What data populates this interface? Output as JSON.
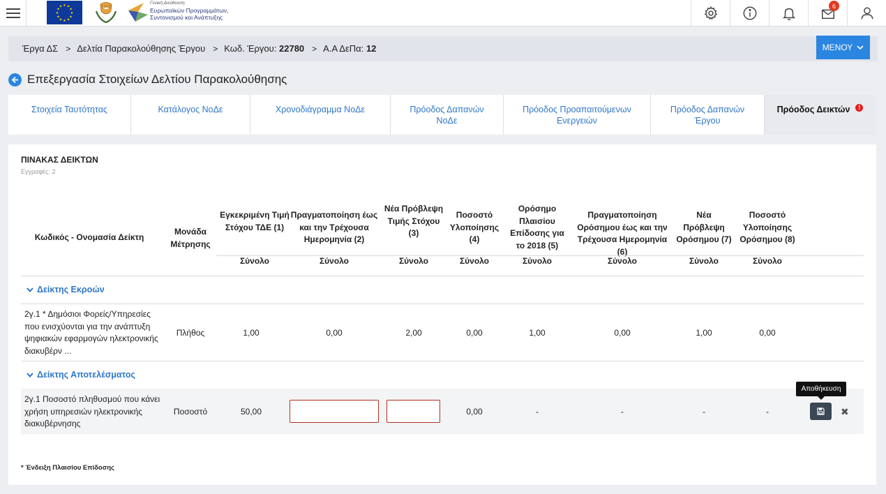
{
  "header": {
    "ministry_logo_line1": "Γενική Διεύθυνση",
    "ministry_logo_line2": "Ευρωπαϊκών Προγραμμάτων,",
    "ministry_logo_line3": "Συντονισμού και Ανάπτυξης",
    "notification_count": "6"
  },
  "breadcrumb": {
    "item1": "Έργα ΔΣ",
    "item2": "Δελτία Παρακολούθησης Έργου",
    "item3_label": "Κωδ. Έργου:",
    "item3_value": "22780",
    "item4_label": "Α.Α ΔεΠα:",
    "item4_value": "12",
    "menu_label": "ΜΕΝΟΥ"
  },
  "page": {
    "title": "Επεξεργασία Στοιχείων Δελτίου Παρακολούθησης"
  },
  "tabs": [
    {
      "label": "Στοιχεία Ταυτότητας"
    },
    {
      "label": "Κατάλογος ΝοΔε"
    },
    {
      "label": "Χρονοδιάγραμμα ΝοΔε"
    },
    {
      "label": "Πρόοδος Δαπανών ΝοΔε"
    },
    {
      "label": "Πρόοδος Προαπαιτούμενων Ενεργειών"
    },
    {
      "label": "Πρόοδος Δαπανών Έργου"
    },
    {
      "label": "Πρόοδος Δεικτών",
      "alert": "!"
    }
  ],
  "table": {
    "title": "ΠΙΝΑΚΑΣ ΔΕΙΚΤΩΝ",
    "record_count": "Εγγραφές: 2",
    "columns": [
      "Κωδικός - Ονομασία Δείκτη",
      "Μονάδα Μέτρησης",
      "Εγκεκριμένη Τιμή Στόχου ΤΔΕ (1)",
      "Πραγματοποίηση έως και την Τρέχουσα Ημερομηνία (2)",
      "Νέα Πρόβλεψη Τιμής Στόχου (3)",
      "Ποσοστό Υλοποίησης (4)",
      "Ορόσημο Πλαισίου Επίδοσης για το 2018 (5)",
      "Πραγματοποίηση Ορόσημου έως και την Τρέχουσα Ημερομηνία (6)",
      "Νέα Πρόβλεψη Ορόσημου (7)",
      "Ποσοστό Υλοποίησης Ορόσημου (8)"
    ],
    "subheader": "Σύνολο",
    "groups": [
      {
        "label": "Δείκτης Εκροών",
        "rows": [
          {
            "name": "2γ.1 * Δημόσιοι Φορείς/Υπηρεσίες που ενισχύονται για την ανάπτυξη ψηφιακών εφαρμογών ηλεκτρονικής διακυβέρν ...",
            "unit": "Πλήθος",
            "c1": "1,00",
            "c2": "0,00",
            "c3": "2,00",
            "c4": "0,00",
            "c5": "1,00",
            "c6": "0,00",
            "c7": "1,00",
            "c8": "0,00"
          }
        ]
      },
      {
        "label": "Δείκτης Αποτελέσματος",
        "rows": [
          {
            "name": "2γ.1 Ποσοστό πληθυσμού που κάνει χρήση υπηρεσιών ηλεκτρονικής διακυβέρνησης",
            "unit": "Ποσοστό",
            "c1": "50,00",
            "c2": "",
            "c3": "",
            "c4": "0,00",
            "c5": "-",
            "c6": "-",
            "c7": "-",
            "c8": "-"
          }
        ]
      }
    ],
    "save_tooltip": "Αποθήκευση",
    "close_symbol": "✖",
    "footnote": "* Ένδειξη Πλαισίου Επίδοσης"
  }
}
